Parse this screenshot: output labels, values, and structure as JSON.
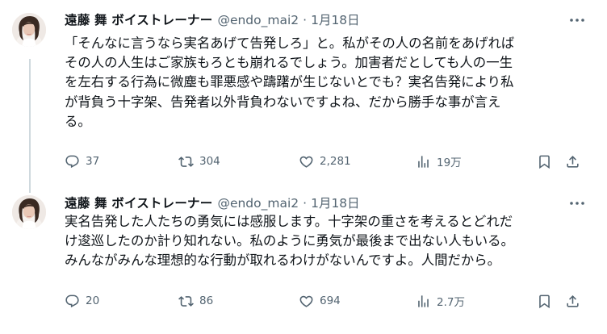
{
  "tweets": [
    {
      "display_name": "遠藤 舞 ボイストレーナー",
      "handle": "@endo_mai2",
      "separator": "·",
      "date": "1月18日",
      "lines": [
        "「そんなに言うなら実名あげて告発しろ」と。私がその人の名前をあげれば",
        "その人の人生はご家族もろとも崩れるでしょう。加害者だとしても人の一生",
        "を左右する行為に微塵も罪悪感や躊躇が生じないとでも？実名告発により私",
        "が背負う十字架、告発者以外背負わないですよね、だから勝手な事が言え",
        "る。"
      ],
      "replies": "37",
      "retweets": "304",
      "likes": "2,281",
      "views": "19万",
      "icons": [
        "reply-icon",
        "retweet-icon",
        "like-icon",
        "views-icon",
        "bookmark-icon",
        "share-icon",
        "more-icon"
      ]
    },
    {
      "display_name": "遠藤 舞 ボイストレーナー",
      "handle": "@endo_mai2",
      "separator": "·",
      "date": "1月18日",
      "lines": [
        "実名告発した人たちの勇気には感服します。十字架の重さを考えるとどれだ",
        "け逡巡したのか計り知れない。私のように勇気が最後まで出ない人もいる。",
        "みんながみんな理想的な行動が取れるわけがないんですよ。人間だから。"
      ],
      "replies": "20",
      "retweets": "86",
      "likes": "694",
      "views": "2.7万",
      "icons": [
        "reply-icon",
        "retweet-icon",
        "like-icon",
        "views-icon",
        "bookmark-icon",
        "share-icon",
        "more-icon"
      ]
    }
  ],
  "colors": {
    "text": "#0f1419",
    "secondary": "#536471",
    "thread_line": "#cfd9de",
    "background": "#ffffff"
  }
}
